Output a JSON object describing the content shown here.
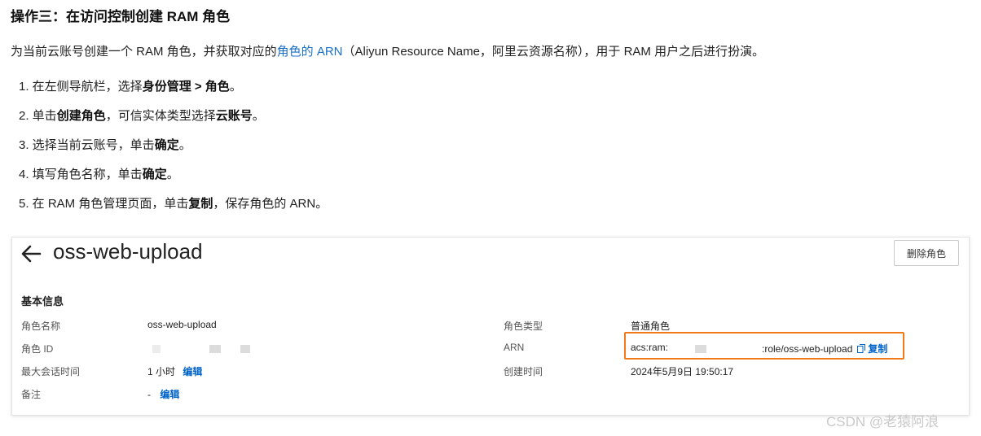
{
  "doc": {
    "heading": "操作三：在访问控制创建 RAM 角色",
    "intro_before": "为当前云账号创建一个 RAM 角色，并获取对应的",
    "intro_link": "角色的 ARN",
    "intro_after": "（Aliyun Resource Name，阿里云资源名称），用于 RAM 用户之后进行扮演。",
    "steps": [
      {
        "a": "1. 在左侧导航栏，选择",
        "b": "身份管理 > 角色",
        "c": "。"
      },
      {
        "a": "2. 单击",
        "b": "创建角色",
        "c": "，可信实体类型选择",
        "d": "云账号",
        "e": "。"
      },
      {
        "a": "3. 选择当前云账号，单击",
        "b": "确定",
        "c": "。"
      },
      {
        "a": "4. 填写角色名称，单击",
        "b": "确定",
        "c": "。"
      },
      {
        "a": "5. 在 RAM 角色管理页面，单击",
        "b": "复制",
        "c": "，保存角色的 ARN。"
      }
    ]
  },
  "card": {
    "title": "oss-web-upload",
    "delete_button": "删除角色",
    "section_title": "基本信息",
    "left": {
      "role_name_label": "角色名称",
      "role_name": "oss-web-upload",
      "role_id_label": "角色 ID",
      "max_session_label": "最大会话时间",
      "max_session": "1 小时",
      "edit": "编辑",
      "note_label": "备注",
      "note": "-",
      "note_edit": "编辑"
    },
    "right": {
      "role_type_label": "角色类型",
      "role_type": "普通角色",
      "arn_label": "ARN",
      "arn_prefix": "acs:ram:",
      "arn_suffix": ":role/oss-web-upload",
      "copy": "复制",
      "created_label": "创建时间",
      "created": "2024年5月9日 19:50:17"
    }
  },
  "watermark": "CSDN @老猿阿浪",
  "colors": {
    "link": "#1a6fc9",
    "action": "#0064c8",
    "highlight": "#f07a1a"
  },
  "icons": {
    "back": "arrow-left-icon",
    "copy": "copy-icon"
  }
}
